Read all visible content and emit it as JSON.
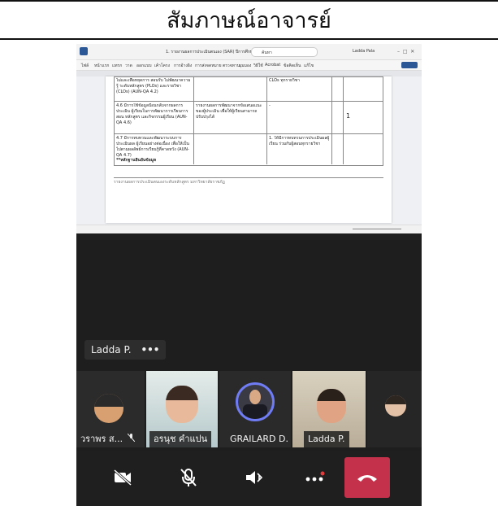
{
  "document": {
    "heading": "สัมภาษณ์อาจารย์"
  },
  "shared_screen": {
    "window_title": "1. รายงานผลการประเมินตนเอง (SAR) ปีการศึกษา...",
    "search_placeholder": "ค้นหา",
    "user_name": "Ladda Pala",
    "ribbon_tabs": [
      "ไฟล์",
      "หน้าแรก",
      "แทรก",
      "วาด",
      "ออกแบบ",
      "เค้าโครง",
      "การอ้างอิง",
      "การส่งจดหมาย",
      "ตรวจทาน",
      "มุมมอง",
      "วิธีใช้",
      "Acrobat",
      "ข้อคิดเห็น",
      "แก้ไข"
    ],
    "table_rows": [
      {
        "left": "ไม่และเพื่อหยุดการ สอนรับ ไม่พัฒนาความรู้ ระดับหลักสูตร (PLOs) และรายวิชา (CLOs) (AUN-QA 4.2)",
        "middle": "",
        "right": "CLOs ทุกรายวิชา"
      },
      {
        "left": "4.6 มีการใช้ข้อมูลป้อนกลับจากผลการประเมิน ผู้เรียนในการพัฒนาการเรียนการสอน หลักสูตร และกิจกรรมผู้เรียน (AUN-QA 4.6)",
        "middle": "รายงานผลการพัฒนาจากข้อเสนอแนะของผู้ประเมิน เพื่อให้ผู้เรียนสามารถปรับปรุงได้",
        "right": "-",
        "mark": "1"
      },
      {
        "left": "4.7 มีการทบทวนและพัฒนาระบบการประเมินผล ผู้เรียนอย่างต่อเนื่อง เพื่อให้เป็นไปตามผลลัพธ์การเรียนรู้ที่คาดหวัง (AUN-QA 4.7)",
        "middle": "",
        "right": "1. ให้มีการทบทวนการประเมินผลผู้เรียน ร่วมกับผู้สอนทุกรายวิชา"
      }
    ],
    "table_note": "**หลักฐานยืนยันข้อมูล",
    "footer": "รายงานผลการประเมินตนเองระดับหลักสูตร มหาวิทยาลัยราชภัฏ"
  },
  "meeting": {
    "active_speaker_label": "Ladda P.",
    "more_label": "•••",
    "participants": [
      {
        "name": "วราพร ส...",
        "muted": true
      },
      {
        "name": "อรนุช คำแปน",
        "muted": false
      },
      {
        "name": "GRAILARD D.",
        "muted": false
      },
      {
        "name": "Ladda P.",
        "muted": false
      }
    ],
    "controls": [
      "camera-off",
      "mic-off",
      "share-screen",
      "more",
      "hang-up"
    ]
  },
  "colors": {
    "hangup": "#c4314b",
    "speaking_border": "#6f7cf4",
    "background": "#1e1e1e"
  }
}
